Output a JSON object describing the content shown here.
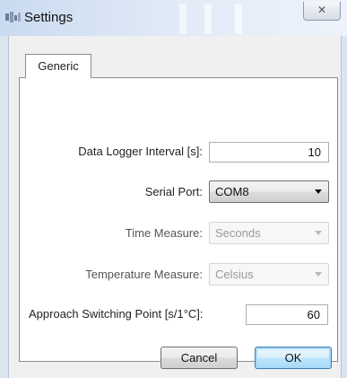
{
  "window": {
    "title": "Settings",
    "close_symbol": "✕",
    "icon": "settings-app-icon"
  },
  "tabs": [
    {
      "label": "Generic",
      "selected": true
    }
  ],
  "fields": {
    "data_logger_interval": {
      "label": "Data Logger Interval [s]:",
      "value": "10"
    },
    "serial_port": {
      "label": "Serial Port:",
      "value": "COM8"
    },
    "time_measure": {
      "label": "Time Measure:",
      "value": "Seconds",
      "enabled": false
    },
    "temperature_measure": {
      "label": "Temperature Measure:",
      "value": "Celsius",
      "enabled": false
    },
    "approach_switching_point": {
      "label": "Approach Switching Point [s/1°C]:",
      "value": "60"
    }
  },
  "buttons": {
    "cancel": "Cancel",
    "ok": "OK"
  },
  "colors": {
    "titlebar": "#dfe9f6",
    "dialog_bg": "#f0f0f0",
    "default_button_border": "#3c7fb1"
  }
}
